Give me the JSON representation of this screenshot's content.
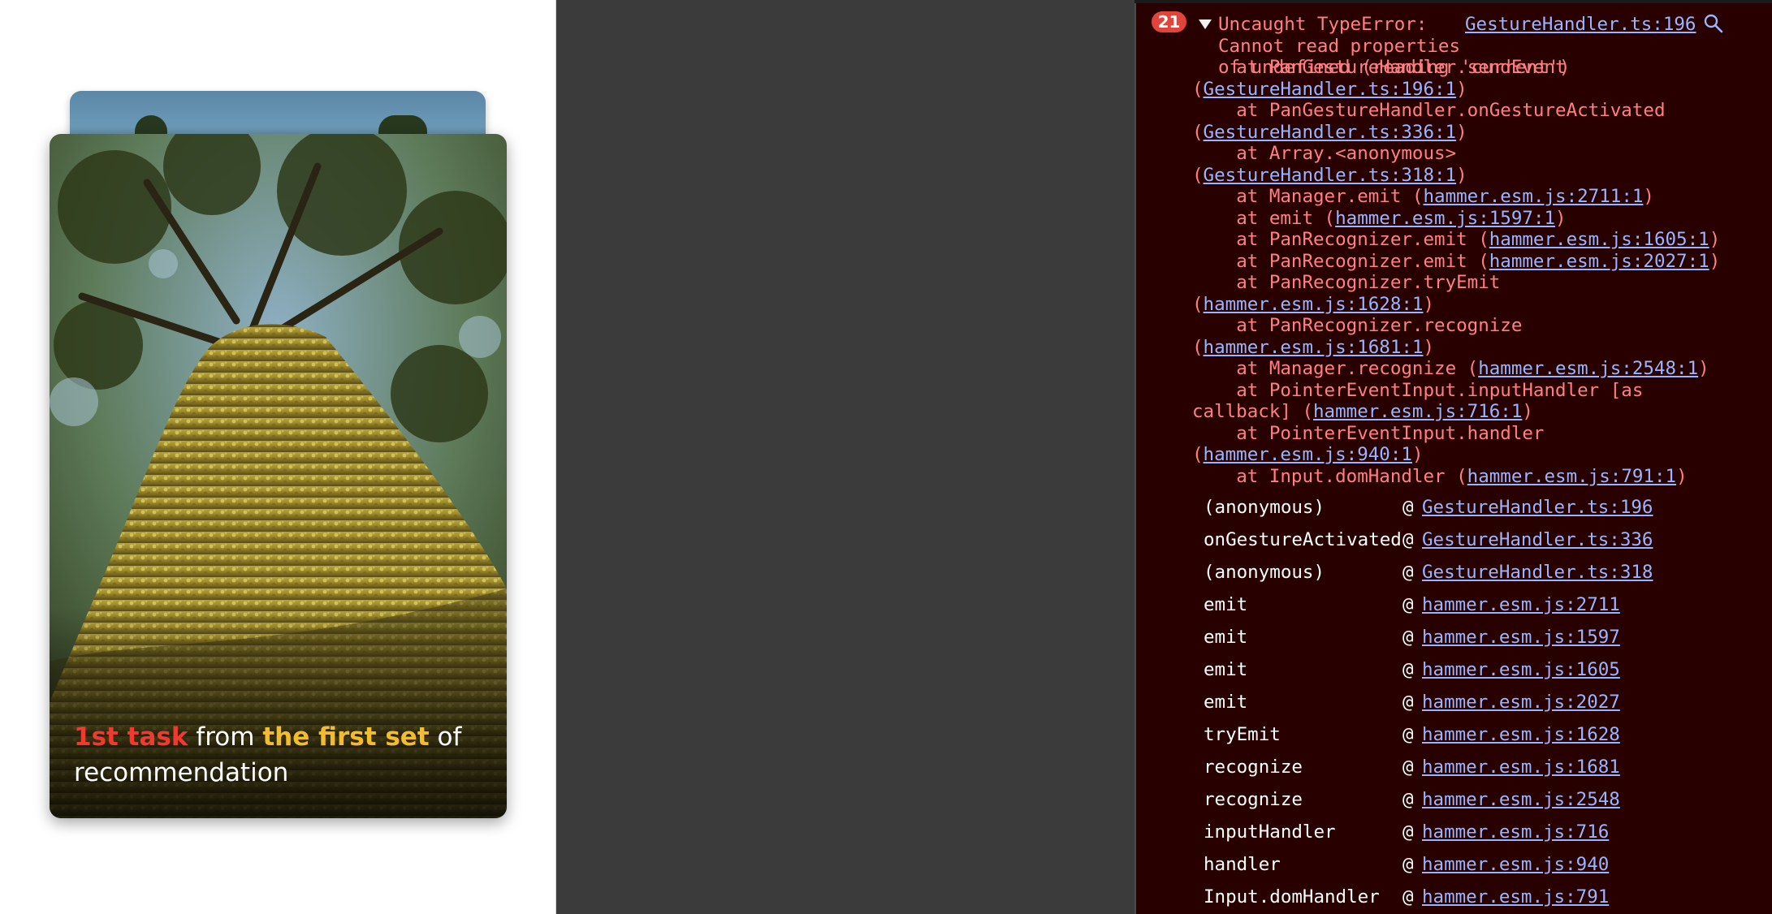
{
  "card": {
    "caption_parts": [
      "1st task",
      " from ",
      "the first set",
      " of recommendation"
    ],
    "highlight_colors": {
      "red": "#ef3b2d",
      "yellow": "#f3bd2a"
    }
  },
  "console": {
    "error_count": "21",
    "error_message": "Uncaught TypeError:\nCannot read properties\nof undefined (reading 'current')",
    "error_source": "GestureHandler.ts:196",
    "trace": [
      {
        "prefix": "    at PanGestureHandler.sendEvent (",
        "link": "GestureHandler.ts:196:1",
        "suffix": ")"
      },
      {
        "prefix": "    at PanGestureHandler.onGestureActivated (",
        "link": "GestureHandler.ts:336:1",
        "suffix": ")"
      },
      {
        "prefix": "    at Array.<anonymous> (",
        "link": "GestureHandler.ts:318:1",
        "suffix": ")"
      },
      {
        "prefix": "    at Manager.emit (",
        "link": "hammer.esm.js:2711:1",
        "suffix": ")"
      },
      {
        "prefix": "    at emit (",
        "link": "hammer.esm.js:1597:1",
        "suffix": ")"
      },
      {
        "prefix": "    at PanRecognizer.emit (",
        "link": "hammer.esm.js:1605:1",
        "suffix": ")"
      },
      {
        "prefix": "    at PanRecognizer.emit (",
        "link": "hammer.esm.js:2027:1",
        "suffix": ")"
      },
      {
        "prefix": "    at PanRecognizer.tryEmit (",
        "link": "hammer.esm.js:1628:1",
        "suffix": ")"
      },
      {
        "prefix": "    at PanRecognizer.recognize (",
        "link": "hammer.esm.js:1681:1",
        "suffix": ")"
      },
      {
        "prefix": "    at Manager.recognize (",
        "link": "hammer.esm.js:2548:1",
        "suffix": ")"
      },
      {
        "prefix": "    at PointerEventInput.inputHandler [as callback] (",
        "link": "hammer.esm.js:716:1",
        "suffix": ")"
      },
      {
        "prefix": "    at PointerEventInput.handler (",
        "link": "hammer.esm.js:940:1",
        "suffix": ")"
      },
      {
        "prefix": "    at Input.domHandler (",
        "link": "hammer.esm.js:791:1",
        "suffix": ")"
      }
    ],
    "stack": [
      {
        "fn": "(anonymous)",
        "link": "GestureHandler.ts:196"
      },
      {
        "fn": "onGestureActivated",
        "link": "GestureHandler.ts:336"
      },
      {
        "fn": "(anonymous)",
        "link": "GestureHandler.ts:318"
      },
      {
        "fn": "emit",
        "link": "hammer.esm.js:2711"
      },
      {
        "fn": "emit",
        "link": "hammer.esm.js:1597"
      },
      {
        "fn": "emit",
        "link": "hammer.esm.js:1605"
      },
      {
        "fn": "emit",
        "link": "hammer.esm.js:2027"
      },
      {
        "fn": "tryEmit",
        "link": "hammer.esm.js:1628"
      },
      {
        "fn": "recognize",
        "link": "hammer.esm.js:1681"
      },
      {
        "fn": "recognize",
        "link": "hammer.esm.js:2548"
      },
      {
        "fn": "inputHandler",
        "link": "hammer.esm.js:716"
      },
      {
        "fn": "handler",
        "link": "hammer.esm.js:940"
      },
      {
        "fn": "Input.domHandler",
        "link": "hammer.esm.js:791"
      }
    ],
    "at_symbol": "@",
    "colors": {
      "background": "#290000",
      "error_text": "#ff8080",
      "link": "#9ab4ff",
      "badge": "#e0443a"
    }
  }
}
